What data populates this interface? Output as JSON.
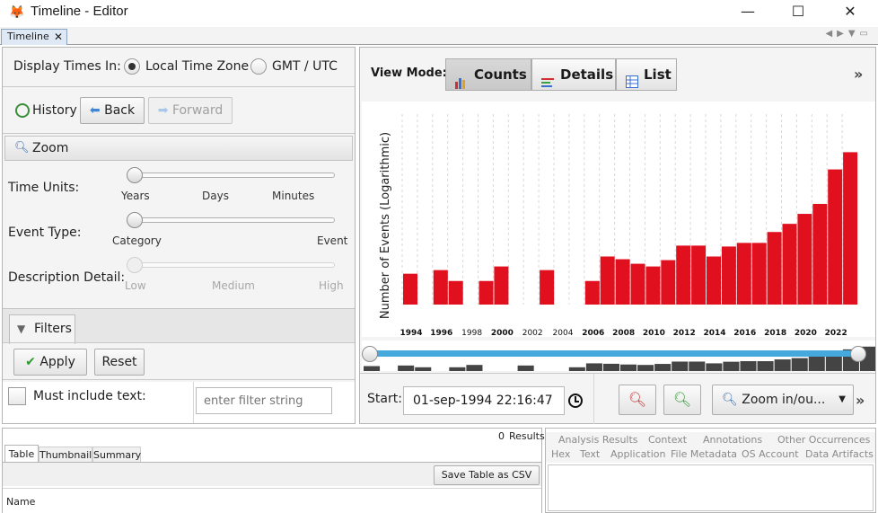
{
  "window": {
    "title": "Timeline - Editor",
    "minimize": "—",
    "maximize": "☐",
    "close": "✕"
  },
  "doc_tab": {
    "label": "Timeline",
    "close": "✕"
  },
  "time_display": {
    "label": "Display Times In:",
    "options": [
      "Local Time Zone",
      "GMT / UTC"
    ],
    "selected": "Local Time Zone"
  },
  "history": {
    "label": "History",
    "back": "Back",
    "forward": "Forward"
  },
  "zoom": {
    "label": "Zoom",
    "time_units": {
      "label": "Time Units:",
      "ticks": [
        "Years",
        "Days",
        "Minutes"
      ],
      "value": 0
    },
    "event_type": {
      "label": "Event Type:",
      "ticks": [
        "Category",
        "Event"
      ],
      "value": 0
    },
    "description_detail": {
      "label": "Description Detail:",
      "ticks": [
        "Low",
        "Medium",
        "High"
      ],
      "value": 0
    }
  },
  "filters": {
    "tab_label": "Filters",
    "apply": "Apply",
    "reset": "Reset",
    "must_include_label": "Must include text:",
    "filter_placeholder": "enter filter string"
  },
  "view_mode": {
    "label": "View Mode:",
    "modes": [
      "Counts",
      "Details",
      "List"
    ],
    "selected": "Counts",
    "more": "»"
  },
  "chart_data": {
    "type": "bar",
    "ylabel": "Number of Events (Logarithmic)",
    "xlabel": "",
    "x_tick_labels": [
      "1994",
      "1996",
      "1998",
      "2000",
      "2002",
      "2004",
      "2006",
      "2008",
      "2010",
      "2012",
      "2014",
      "2016",
      "2018",
      "2020",
      "2022"
    ],
    "x_tick_bold": [
      "1994",
      "1996",
      "2000",
      "2006",
      "2008",
      "2010",
      "2012",
      "2014",
      "2016",
      "2018",
      "2020",
      "2022"
    ],
    "categories": [
      "1994",
      "1995",
      "1996",
      "1997",
      "1998",
      "1999",
      "2000",
      "2001",
      "2002",
      "2003",
      "2004",
      "2005",
      "2006",
      "2007",
      "2008",
      "2009",
      "2010",
      "2011",
      "2012",
      "2013",
      "2014",
      "2015",
      "2016",
      "2017",
      "2018",
      "2019",
      "2020",
      "2021",
      "2022",
      "2023"
    ],
    "values": [
      34,
      0,
      38,
      26,
      0,
      26,
      42,
      0,
      0,
      38,
      0,
      0,
      26,
      53,
      50,
      45,
      42,
      49,
      65,
      65,
      53,
      64,
      68,
      68,
      80,
      89,
      100,
      111,
      149,
      168
    ],
    "value_max": 210,
    "color": "#e0101f"
  },
  "overview": {
    "start_value": 0,
    "end_value": 1
  },
  "time_range": {
    "start_label": "Start:",
    "start_value": "01-sep-1994 22:16:47",
    "zoom_label": "Zoom in/ou...",
    "more": "»"
  },
  "results": {
    "tabs": [
      "Table",
      "Thumbnail",
      "Summary"
    ],
    "count": "0",
    "count_label": "Results",
    "save_csv": "Save Table as CSV",
    "column_name": "Name"
  },
  "content_viewer": {
    "tabs_top": [
      "Analysis Results",
      "Context",
      "Annotations",
      "Other Occurrences"
    ],
    "tabs_bottom": [
      "Hex",
      "Text",
      "Application",
      "File Metadata",
      "OS Account",
      "Data Artifacts"
    ]
  }
}
